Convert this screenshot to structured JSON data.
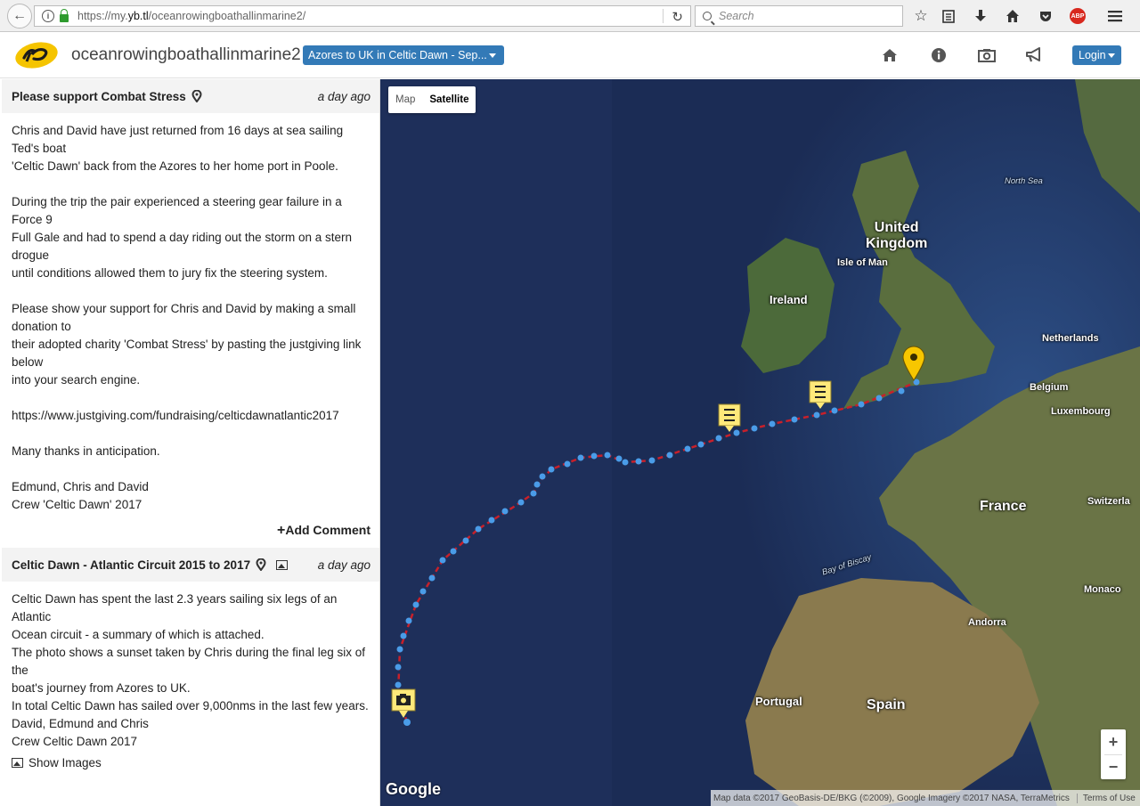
{
  "browser": {
    "url_prefix": "https://my.",
    "url_domain": "yb.tl",
    "url_path": "/oceanrowingboathallinmarine2/",
    "search_placeholder": "Search",
    "abp_label": "ABP"
  },
  "header": {
    "site_title": "oceanrowingboathallinmarine2",
    "race_select_value": "Azores to UK in Celtic Dawn - Sep...",
    "login_label": "Login"
  },
  "posts": [
    {
      "title": "Please support Combat Stress",
      "time": "a day ago",
      "lines": [
        "Chris and David have just returned from 16 days at sea sailing Ted's boat",
        "'Celtic Dawn' back from the Azores to her home port in Poole.",
        "",
        "During the trip the pair experienced a steering gear failure in a Force 9",
        "Full Gale and had to spend a day riding out the storm on a stern drogue",
        "until conditions allowed them to jury fix the steering system.",
        "",
        "Please show your support for Chris and David by making a small donation to",
        "their adopted charity 'Combat Stress' by pasting the justgiving link below",
        "into your search engine.",
        "",
        "https://www.justgiving.com/fundraising/celticdawnatlantic2017",
        "",
        "Many thanks in anticipation.",
        "",
        "Edmund, Chris and David",
        "Crew 'Celtic Dawn' 2017"
      ],
      "add_comment": "Add Comment"
    },
    {
      "title": "Celtic Dawn - Atlantic Circuit 2015 to 2017",
      "time": "a day ago",
      "lines": [
        "Celtic Dawn has spent the last 2.3 years sailing six legs of an Atlantic",
        "Ocean circuit - a summary of which is attached.",
        "The photo shows a sunset taken by Chris during the final leg six of the",
        "boat's journey from Azores to UK.",
        "In total Celtic Dawn has sailed over 9,000nms in the last few years.",
        "David, Edmund and Chris",
        "Crew Celtic Dawn 2017"
      ],
      "show_images": "Show Images"
    }
  ],
  "map": {
    "type_map": "Map",
    "type_satellite": "Satellite",
    "labels": {
      "north_sea": "North Sea",
      "uk_line1": "United",
      "uk_line2": "Kingdom",
      "isle_of_man": "Isle of Man",
      "ireland": "Ireland",
      "netherlands": "Netherlands",
      "belgium": "Belgium",
      "luxembourg": "Luxembourg",
      "france": "France",
      "switzerland": "Switzerla",
      "bay_of_biscay": "Bay of Biscay",
      "monaco": "Monaco",
      "andorra": "Andorra",
      "portugal": "Portugal",
      "spain": "Spain"
    },
    "google": "Google",
    "attribution": "Map data ©2017 GeoBasis-DE/BKG (©2009), Google Imagery ©2017 NASA, TerraMetrics",
    "terms": "Terms of Use",
    "zoom_in": "+",
    "zoom_out": "−",
    "colors": {
      "track_line": "#c8202a",
      "track_dots": "#4a9ce8",
      "marker_yellow": "#f7c600",
      "note_marker": "#ffe97a"
    }
  }
}
